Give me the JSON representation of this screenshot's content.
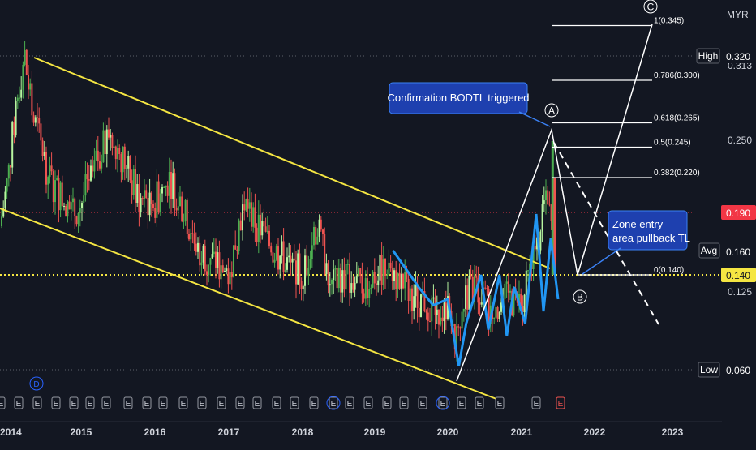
{
  "currency": "MYR",
  "colors": {
    "background": "#131722",
    "bull": "#4caf50",
    "bull_light": "#b7f5a0",
    "bear": "#ef5350",
    "channel": "#f5e642",
    "wave": "#2196f3",
    "fib": "#ffffff",
    "callout": "#1e40af",
    "last_price": "#f5e642",
    "close_tag": "#f23645"
  },
  "chart_data": {
    "type": "line",
    "title": "",
    "xlabel": "",
    "ylabel": "",
    "x_ticks": [
      "2015",
      "2016",
      "2017",
      "2018",
      "2019",
      "2020",
      "2021",
      "2022",
      "2023"
    ],
    "x_edge_label": "2014",
    "y_ticks": [
      "0.125",
      "0.250",
      "0.313"
    ],
    "ylim": [
      0.04,
      0.36
    ],
    "price_tags": [
      {
        "label": "High",
        "value": "0.320",
        "type": "labeled"
      },
      {
        "label": "",
        "value": "0.190",
        "type": "close"
      },
      {
        "label": "Avg",
        "value": "0.160",
        "type": "labeled"
      },
      {
        "label": "",
        "value": "0.140",
        "type": "last"
      },
      {
        "label": "Low",
        "value": "0.060",
        "type": "labeled"
      }
    ],
    "series": [
      {
        "type": "candles",
        "approx_x": [
          2014.0,
          2014.1,
          2014.2,
          2014.3,
          2014.4,
          2014.5,
          2014.6,
          2014.7,
          2014.8,
          2014.9,
          2015.0,
          2015.2,
          2015.4,
          2015.6,
          2015.8,
          2016.0,
          2016.2,
          2016.4,
          2016.6,
          2016.8,
          2017.0,
          2017.2,
          2017.4,
          2017.6,
          2017.8,
          2018.0,
          2018.2,
          2018.4,
          2018.6,
          2018.8,
          2019.0,
          2019.2,
          2019.4,
          2019.6,
          2019.8,
          2020.0,
          2020.1,
          2020.2,
          2020.4,
          2020.6,
          2020.8,
          2021.0,
          2021.2,
          2021.3,
          2021.4
        ],
        "approx_close": [
          0.18,
          0.22,
          0.28,
          0.32,
          0.27,
          0.25,
          0.22,
          0.21,
          0.2,
          0.19,
          0.2,
          0.23,
          0.26,
          0.23,
          0.2,
          0.2,
          0.22,
          0.19,
          0.16,
          0.15,
          0.14,
          0.2,
          0.18,
          0.16,
          0.15,
          0.14,
          0.18,
          0.13,
          0.14,
          0.13,
          0.14,
          0.15,
          0.13,
          0.12,
          0.115,
          0.11,
          0.08,
          0.12,
          0.13,
          0.11,
          0.12,
          0.115,
          0.16,
          0.2,
          0.19
        ]
      }
    ],
    "wave": {
      "x": [
        2019.25,
        2019.6,
        2019.8,
        2020.0,
        2020.15,
        2020.25,
        2020.45,
        2020.55,
        2020.7,
        2020.8,
        2020.9,
        2021.05,
        2021.2,
        2021.3,
        2021.4,
        2021.5
      ],
      "y": [
        0.16,
        0.13,
        0.115,
        0.12,
        0.065,
        0.1,
        0.14,
        0.095,
        0.14,
        0.09,
        0.13,
        0.1,
        0.19,
        0.11,
        0.17,
        0.12
      ]
    },
    "channel": {
      "upper": {
        "x": [
          2014.3,
          2021.6
        ],
        "y": [
          0.32,
          0.135
        ]
      },
      "lower": {
        "x": [
          2013.8,
          2020.85
        ],
        "y": [
          0.19,
          0.048
        ]
      }
    },
    "abc": {
      "points": [
        {
          "label": "A",
          "x": 2021.45,
          "y": 0.255
        },
        {
          "label": "B",
          "x": 2021.85,
          "y": 0.14
        },
        {
          "label": "C",
          "x": 2022.8,
          "y": 0.345
        }
      ],
      "start": {
        "x": 2020.1,
        "y": 0.05
      }
    },
    "fib_levels": [
      {
        "label": "1(0.345)",
        "value": 0.345
      },
      {
        "label": "0.786(0.300)",
        "value": 0.3
      },
      {
        "label": "0.618(0.265)",
        "value": 0.265
      },
      {
        "label": "0.5(0.245)",
        "value": 0.245
      },
      {
        "label": "0.382(0.220)",
        "value": 0.22
      },
      {
        "label": "0(0.140)",
        "value": 0.14
      }
    ],
    "annotations": [
      "Confirmation BODTL triggered",
      "Zone entry\narea pullback TL"
    ],
    "events": {
      "letters": [
        "E",
        "E",
        "E",
        "E",
        "E",
        "E",
        "E",
        "E",
        "E",
        "E",
        "E",
        "E",
        "E",
        "E",
        "E",
        "E",
        "E",
        "E",
        "E",
        "E",
        "E",
        "E",
        "E",
        "E",
        "E",
        "E",
        "E",
        "E",
        "E",
        "E"
      ],
      "circle_d": "D"
    }
  }
}
